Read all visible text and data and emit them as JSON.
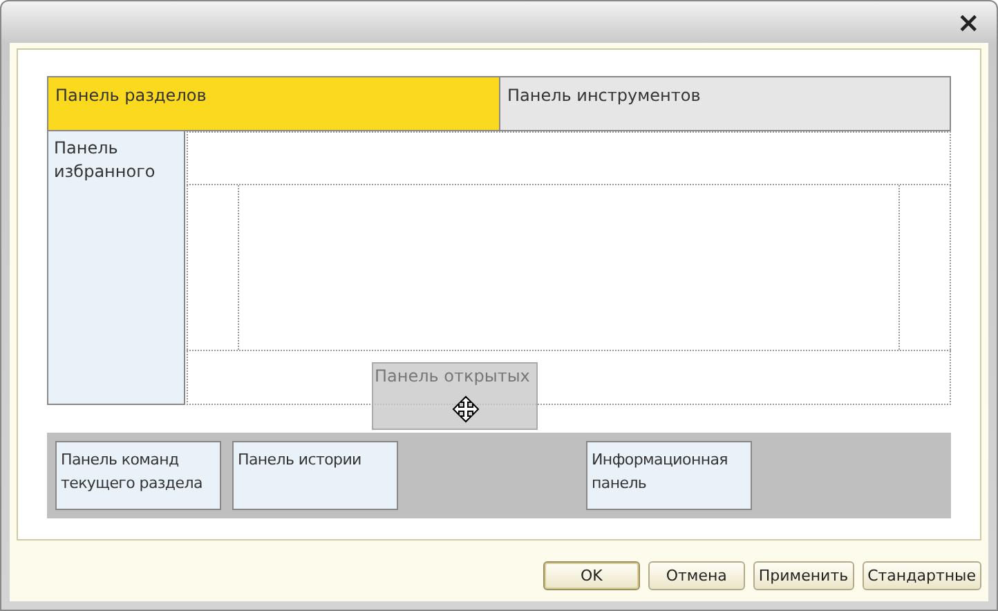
{
  "window": {
    "close": "×"
  },
  "layout": {
    "sections_panel": "Панель разделов",
    "tools_panel": "Панель инструментов",
    "favorites_panel": "Панель избранного",
    "dragged_panel": "Панель открытых",
    "bottom_panels": [
      {
        "label": "Панель команд текущего раздела"
      },
      {
        "label": "Панель истории"
      },
      {
        "label": "Информационная панель"
      }
    ]
  },
  "buttons": [
    {
      "label": "OK",
      "default": true
    },
    {
      "label": "Отмена",
      "default": false
    },
    {
      "label": "Применить",
      "default": false
    },
    {
      "label": "Стандартные",
      "default": false
    }
  ]
}
